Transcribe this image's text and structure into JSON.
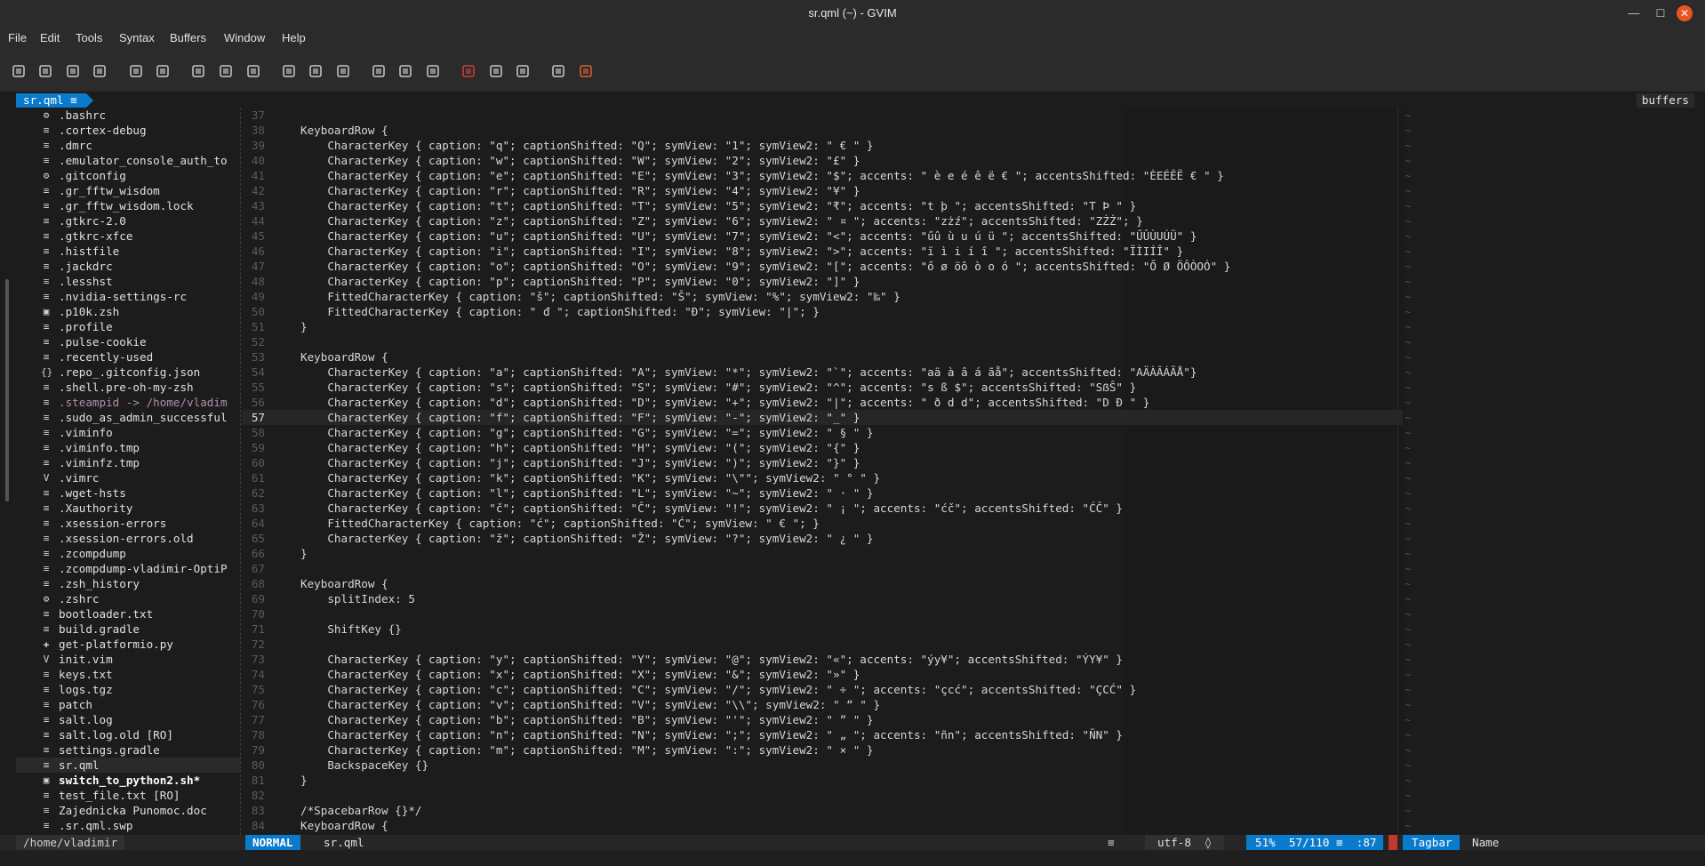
{
  "window": {
    "title": "sr.qml (~) - GVIM"
  },
  "menu": [
    "File",
    "Edit",
    "Tools",
    "Syntax",
    "Buffers",
    "Window",
    "Help"
  ],
  "toolbar_icons": [
    "open-icon",
    "load-session-icon",
    "save-icon",
    "print-icon",
    "undo-icon",
    "redo-icon",
    "cut-icon",
    "copy-icon",
    "paste-icon",
    "find-replace-icon",
    "find-next-icon",
    "find-prev-icon",
    "load-settings-icon",
    "save-settings-icon",
    "make-icon",
    "run-ctags-icon",
    "table-icon",
    "jump-tag-icon",
    "help-icon",
    "find-help-icon"
  ],
  "tabline": {
    "active": "sr.qml",
    "right": "buffers"
  },
  "nerdtree": [
    {
      "icon": "⚙",
      "name": ".bashrc"
    },
    {
      "icon": "≡",
      "name": ".cortex-debug"
    },
    {
      "icon": "≡",
      "name": ".dmrc"
    },
    {
      "icon": "≡",
      "name": ".emulator_console_auth_to"
    },
    {
      "icon": "⚙",
      "name": ".gitconfig"
    },
    {
      "icon": "≡",
      "name": ".gr_fftw_wisdom"
    },
    {
      "icon": "≡",
      "name": ".gr_fftw_wisdom.lock"
    },
    {
      "icon": "≡",
      "name": ".gtkrc-2.0"
    },
    {
      "icon": "≡",
      "name": ".gtkrc-xfce"
    },
    {
      "icon": "≡",
      "name": ".histfile"
    },
    {
      "icon": "≡",
      "name": ".jackdrc"
    },
    {
      "icon": "≡",
      "name": ".lesshst"
    },
    {
      "icon": "≡",
      "name": ".nvidia-settings-rc"
    },
    {
      "icon": "▣",
      "name": ".p10k.zsh"
    },
    {
      "icon": "≡",
      "name": ".profile"
    },
    {
      "icon": "≡",
      "name": ".pulse-cookie"
    },
    {
      "icon": "≡",
      "name": ".recently-used"
    },
    {
      "icon": "{}",
      "name": ".repo_.gitconfig.json"
    },
    {
      "icon": "≡",
      "name": ".shell.pre-oh-my-zsh"
    },
    {
      "icon": "≡",
      "name": ".steampid -> /home/vladim"
    },
    {
      "icon": "≡",
      "name": ".sudo_as_admin_successful"
    },
    {
      "icon": "≡",
      "name": ".viminfo"
    },
    {
      "icon": "≡",
      "name": ".viminfo.tmp"
    },
    {
      "icon": "≡",
      "name": ".viminfz.tmp"
    },
    {
      "icon": "V",
      "name": ".vimrc"
    },
    {
      "icon": "≡",
      "name": ".wget-hsts"
    },
    {
      "icon": "≡",
      "name": ".Xauthority"
    },
    {
      "icon": "≡",
      "name": ".xsession-errors"
    },
    {
      "icon": "≡",
      "name": ".xsession-errors.old"
    },
    {
      "icon": "≡",
      "name": ".zcompdump"
    },
    {
      "icon": "≡",
      "name": ".zcompdump-vladimir-OptiP"
    },
    {
      "icon": "≡",
      "name": ".zsh_history"
    },
    {
      "icon": "⚙",
      "name": ".zshrc"
    },
    {
      "icon": "≡",
      "name": "bootloader.txt"
    },
    {
      "icon": "≡",
      "name": "build.gradle"
    },
    {
      "icon": "✚",
      "name": "get-platformio.py"
    },
    {
      "icon": "V",
      "name": "init.vim"
    },
    {
      "icon": "≡",
      "name": "keys.txt"
    },
    {
      "icon": "≡",
      "name": "logs.tgz"
    },
    {
      "icon": "≡",
      "name": "patch"
    },
    {
      "icon": "≡",
      "name": "salt.log"
    },
    {
      "icon": "≡",
      "name": "salt.log.old [RO]"
    },
    {
      "icon": "≡",
      "name": "settings.gradle"
    },
    {
      "icon": "≡",
      "name": "sr.qml"
    },
    {
      "icon": "▣",
      "name": "switch_to_python2.sh*"
    },
    {
      "icon": "≡",
      "name": "test_file.txt [RO]"
    },
    {
      "icon": "≡",
      "name": "Zajednicka Punomoc.doc"
    },
    {
      "icon": "≡",
      "name": ".sr.qml.swp"
    }
  ],
  "code": [
    {
      "n": "37",
      "t": ""
    },
    {
      "n": "38",
      "t": "KeyboardRow {"
    },
    {
      "n": "39",
      "t": "    CharacterKey { caption: \"q\"; captionShifted: \"Q\"; symView: \"1\"; symView2: \" € \" }"
    },
    {
      "n": "40",
      "t": "    CharacterKey { caption: \"w\"; captionShifted: \"W\"; symView: \"2\"; symView2: \"£\" }"
    },
    {
      "n": "41",
      "t": "    CharacterKey { caption: \"e\"; captionShifted: \"E\"; symView: \"3\"; symView2: \"$\"; accents: \" è e é ê ë € \"; accentsShifted: \"ÈEÉÊË € \" }"
    },
    {
      "n": "42",
      "t": "    CharacterKey { caption: \"r\"; captionShifted: \"R\"; symView: \"4\"; symView2: \"¥\" }"
    },
    {
      "n": "43",
      "t": "    CharacterKey { caption: \"t\"; captionShifted: \"T\"; symView: \"5\"; symView2: \"₹\"; accents: \"t þ \"; accentsShifted: \"T Þ \" }"
    },
    {
      "n": "44",
      "t": "    CharacterKey { caption: \"z\"; captionShifted: \"Z\"; symView: \"6\"; symView2: \" ¤ \"; accents: \"zżź\"; accentsShifted: \"ZŻŹ\"; }"
    },
    {
      "n": "45",
      "t": "    CharacterKey { caption: \"u\"; captionShifted: \"U\"; symView: \"7\"; symView2: \"<\"; accents: \"űû ù u ú ü \"; accentsShifted: \"ŰÛÙUÚÜ\" }"
    },
    {
      "n": "46",
      "t": "    CharacterKey { caption: \"i\"; captionShifted: \"I\"; symView: \"8\"; symView2: \">\"; accents: \"ï ì i í î \"; accentsShifted: \"ÏÌIÍÎ\" }"
    },
    {
      "n": "47",
      "t": "    CharacterKey { caption: \"o\"; captionShifted: \"O\"; symView: \"9\"; symView2: \"[\"; accents: \"ő ø öô ò o ó \"; accentsShifted: \"Ő Ø ÖÔÒOÓ\" }"
    },
    {
      "n": "48",
      "t": "    CharacterKey { caption: \"p\"; captionShifted: \"P\"; symView: \"0\"; symView2: \"]\" }"
    },
    {
      "n": "49",
      "t": "    FittedCharacterKey { caption: \"š\"; captionShifted: \"Š\"; symView: \"%\"; symView2: \"‰\" }"
    },
    {
      "n": "50",
      "t": "    FittedCharacterKey { caption: \" đ \"; captionShifted: \"Đ\"; symView: \"|\"; }"
    },
    {
      "n": "51",
      "t": "}"
    },
    {
      "n": "52",
      "t": ""
    },
    {
      "n": "53",
      "t": "KeyboardRow {"
    },
    {
      "n": "54",
      "t": "    CharacterKey { caption: \"a\"; captionShifted: \"A\"; symView: \"*\"; symView2: \"`\"; accents: \"aä à â á ãå\"; accentsShifted: \"AÄÀÂÁÃÅ\"}"
    },
    {
      "n": "55",
      "t": "    CharacterKey { caption: \"s\"; captionShifted: \"S\"; symView: \"#\"; symView2: \"^\"; accents: \"s ß $\"; accentsShifted: \"SẞŜ\" }"
    },
    {
      "n": "56",
      "t": "    CharacterKey { caption: \"d\"; captionShifted: \"D\"; symView: \"+\"; symView2: \"|\"; accents: \" ð d d\"; accentsShifted: \"D Đ \" }"
    },
    {
      "n": "57",
      "t": "    CharacterKey { caption: \"f\"; captionShifted: \"F\"; symView: \"-\"; symView2: \"_\" }"
    },
    {
      "n": "58",
      "t": "    CharacterKey { caption: \"g\"; captionShifted: \"G\"; symView: \"=\"; symView2: \" § \" }"
    },
    {
      "n": "59",
      "t": "    CharacterKey { caption: \"h\"; captionShifted: \"H\"; symView: \"(\"; symView2: \"{\" }"
    },
    {
      "n": "60",
      "t": "    CharacterKey { caption: \"j\"; captionShifted: \"J\"; symView: \")\"; symView2: \"}\" }"
    },
    {
      "n": "61",
      "t": "    CharacterKey { caption: \"k\"; captionShifted: \"K\"; symView: \"\\\"\"; symView2: \" ° \" }"
    },
    {
      "n": "62",
      "t": "    CharacterKey { caption: \"l\"; captionShifted: \"L\"; symView: \"~\"; symView2: \" · \" }"
    },
    {
      "n": "63",
      "t": "    CharacterKey { caption: \"č\"; captionShifted: \"Č\"; symView: \"!\"; symView2: \" ¡ \"; accents: \"ćč\"; accentsShifted: \"ĆČ\" }"
    },
    {
      "n": "64",
      "t": "    FittedCharacterKey { caption: \"ć\"; captionShifted: \"Ć\"; symView: \" € \"; }"
    },
    {
      "n": "65",
      "t": "    CharacterKey { caption: \"ž\"; captionShifted: \"Ž\"; symView: \"?\"; symView2: \" ¿ \" }"
    },
    {
      "n": "66",
      "t": "}"
    },
    {
      "n": "67",
      "t": ""
    },
    {
      "n": "68",
      "t": "KeyboardRow {"
    },
    {
      "n": "69",
      "t": "    splitIndex: 5"
    },
    {
      "n": "70",
      "t": ""
    },
    {
      "n": "71",
      "t": "    ShiftKey {}"
    },
    {
      "n": "72",
      "t": ""
    },
    {
      "n": "73",
      "t": "    CharacterKey { caption: \"y\"; captionShifted: \"Y\"; symView: \"@\"; symView2: \"«\"; accents: \"ýy¥\"; accentsShifted: \"ÝY¥\" }"
    },
    {
      "n": "74",
      "t": "    CharacterKey { caption: \"x\"; captionShifted: \"X\"; symView: \"&\"; symView2: \"»\" }"
    },
    {
      "n": "75",
      "t": "    CharacterKey { caption: \"c\"; captionShifted: \"C\"; symView: \"/\"; symView2: \" ÷ \"; accents: \"çcć\"; accentsShifted: \"ÇCĆ\" }"
    },
    {
      "n": "76",
      "t": "    CharacterKey { caption: \"v\"; captionShifted: \"V\"; symView: \"\\\\\"; symView2: \" “ \" }"
    },
    {
      "n": "77",
      "t": "    CharacterKey { caption: \"b\"; captionShifted: \"B\"; symView: \"'\"; symView2: \" ” \" }"
    },
    {
      "n": "78",
      "t": "    CharacterKey { caption: \"n\"; captionShifted: \"N\"; symView: \";\"; symView2: \" „ \"; accents: \"ñn\"; accentsShifted: \"ÑN\" }"
    },
    {
      "n": "79",
      "t": "    CharacterKey { caption: \"m\"; captionShifted: \"M\"; symView: \":\"; symView2: \" × \" }"
    },
    {
      "n": "80",
      "t": "    BackspaceKey {}"
    },
    {
      "n": "81",
      "t": "}"
    },
    {
      "n": "82",
      "t": ""
    },
    {
      "n": "83",
      "t": "/*SpacebarRow {}*/"
    },
    {
      "n": "84",
      "t": "KeyboardRow {"
    }
  ],
  "current_line": "57",
  "tagbar_filler": "~",
  "statusline": {
    "path": "/home/vladimir",
    "mode": "NORMAL",
    "file": "sr.qml",
    "filetype_icon": "≡",
    "encoding": "utf-8",
    "os_icon": "",
    "position": "51%  57/110 ≡  :87",
    "tagbar": "Tagbar",
    "tagbar_sort": "Name"
  },
  "colors": {
    "accent": "#0a7acc",
    "background": "#1c1c1c",
    "chrome": "#2b2b2b"
  }
}
